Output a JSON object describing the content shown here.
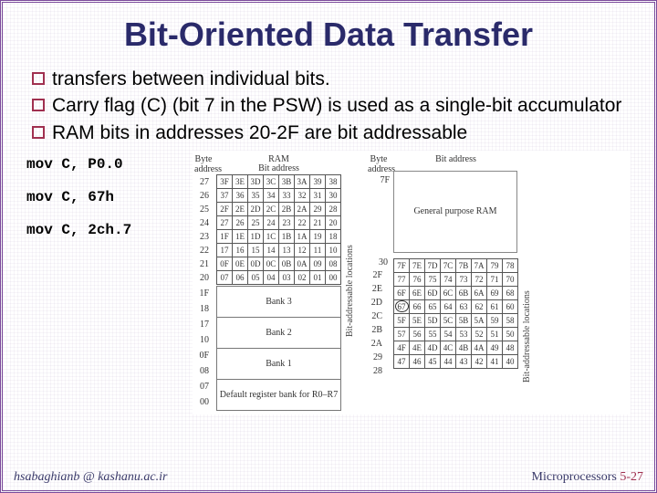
{
  "title": "Bit-Oriented Data Transfer",
  "bullets": [
    "transfers between individual bits.",
    "Carry flag (C) (bit 7 in the PSW) is used as a single-bit accumulator",
    "RAM bits in addresses 20-2F are bit addressable"
  ],
  "code": [
    "mov C, P0.0",
    "mov C, 67h",
    "mov C, 2ch.7"
  ],
  "diagram": {
    "ram_label": "RAM",
    "byte_addr_hdr": "Byte\naddress",
    "bit_addr_hdr": "Bit address",
    "left_byte_addrs": [
      "27",
      "26",
      "25",
      "24",
      "23",
      "22",
      "21",
      "20"
    ],
    "left_bit_rows": [
      [
        "3F",
        "3E",
        "3D",
        "3C",
        "3B",
        "3A",
        "39",
        "38"
      ],
      [
        "37",
        "36",
        "35",
        "34",
        "33",
        "32",
        "31",
        "30"
      ],
      [
        "2F",
        "2E",
        "2D",
        "2C",
        "2B",
        "2A",
        "29",
        "28"
      ],
      [
        "27",
        "26",
        "25",
        "24",
        "23",
        "22",
        "21",
        "20"
      ],
      [
        "1F",
        "1E",
        "1D",
        "1C",
        "1B",
        "1A",
        "19",
        "18"
      ],
      [
        "17",
        "16",
        "15",
        "14",
        "13",
        "12",
        "11",
        "10"
      ],
      [
        "0F",
        "0E",
        "0D",
        "0C",
        "0B",
        "0A",
        "09",
        "08"
      ],
      [
        "07",
        "06",
        "05",
        "04",
        "03",
        "02",
        "01",
        "00"
      ]
    ],
    "bank_addrs": [
      "1F",
      "18",
      "17",
      "10",
      "0F",
      "08",
      "07",
      "00"
    ],
    "banks": [
      "Bank 3",
      "Bank 2",
      "Bank 1",
      "Default register bank for R0–R7"
    ],
    "left_vlabel": "Bit-addressable locations",
    "right_byte_hdr": "Byte\naddress",
    "right_top_addr": "7F",
    "gp_label": "General purpose RAM",
    "right_mid_addr": "30",
    "right_byte_addrs": [
      "2F",
      "2E",
      "2D",
      "2C",
      "2B",
      "2A",
      "29",
      "28"
    ],
    "right_bit_rows": [
      [
        "7F",
        "7E",
        "7D",
        "7C",
        "7B",
        "7A",
        "79",
        "78"
      ],
      [
        "77",
        "76",
        "75",
        "74",
        "73",
        "72",
        "71",
        "70"
      ],
      [
        "6F",
        "6E",
        "6D",
        "6C",
        "6B",
        "6A",
        "69",
        "68"
      ],
      [
        "67",
        "66",
        "65",
        "64",
        "63",
        "62",
        "61",
        "60"
      ],
      [
        "5F",
        "5E",
        "5D",
        "5C",
        "5B",
        "5A",
        "59",
        "58"
      ],
      [
        "57",
        "56",
        "55",
        "54",
        "53",
        "52",
        "51",
        "50"
      ],
      [
        "4F",
        "4E",
        "4D",
        "4C",
        "4B",
        "4A",
        "49",
        "48"
      ],
      [
        "47",
        "46",
        "45",
        "44",
        "43",
        "42",
        "41",
        "40"
      ]
    ],
    "right_vlabel": "Bit-addressable locations",
    "circled_cell": "67"
  },
  "footer": {
    "left": "hsabaghianb @ kashanu.ac.ir",
    "right_label": "Microprocessors ",
    "page": "5-27"
  }
}
